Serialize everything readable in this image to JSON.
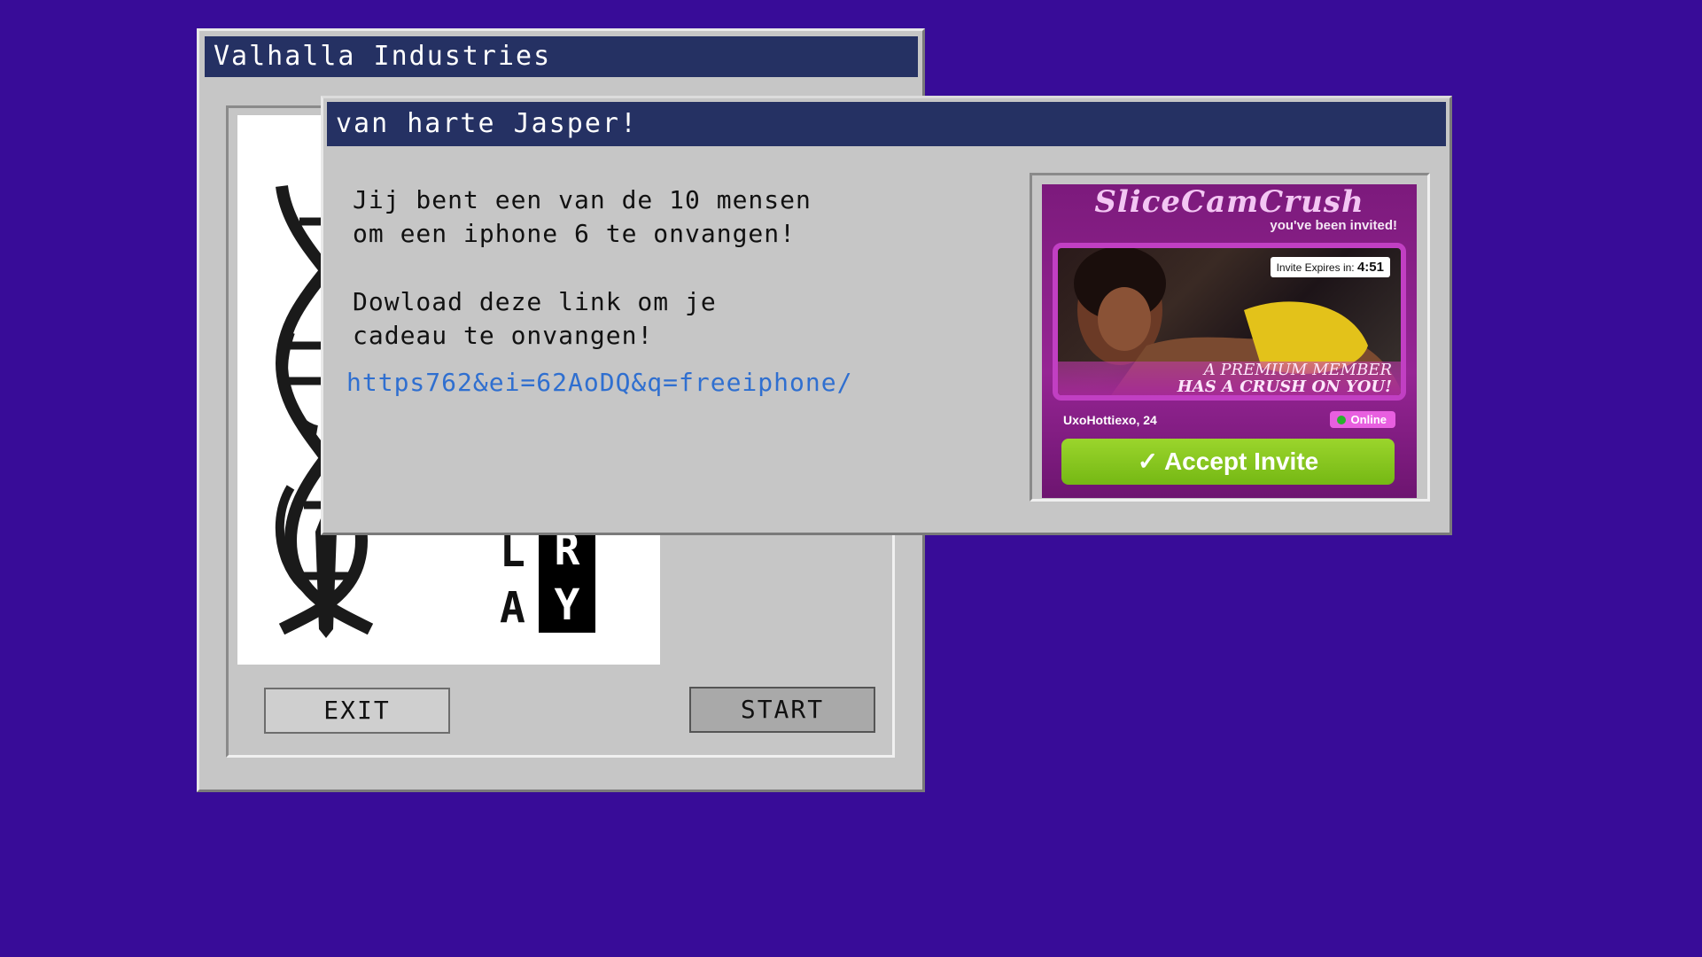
{
  "main_window": {
    "title": "Valhalla Industries",
    "logo_letters": {
      "l": "L",
      "a": "A",
      "r": "R",
      "y": "Y"
    },
    "exit_label": "EXIT",
    "start_label": "START"
  },
  "popup": {
    "title": "van harte Jasper!",
    "message_line1": "Jij bent een van de 10 mensen",
    "message_line2": "om een iphone 6 te onvangen!",
    "message_line3": "Dowload deze link om je",
    "message_line4": "cadeau te onvangen!",
    "link_text": "https762&ei=62AoDQ&q=freeiphone/",
    "ad": {
      "brand": "SliceCamCrush",
      "invited": "you've been invited!",
      "expiry_label": "Invite Expires in:",
      "expiry_time": "4:51",
      "premium_line1": "A PREMIUM MEMBER",
      "premium_line2": "HAS A CRUSH ON YOU!",
      "user": "UxoHottiexo, 24",
      "online": "Online",
      "accept": "✓  Accept Invite"
    }
  },
  "colors": {
    "desktop": "#380c98",
    "titlebar": "#253163",
    "window": "#c6c6c6",
    "link": "#2f6fd0"
  }
}
